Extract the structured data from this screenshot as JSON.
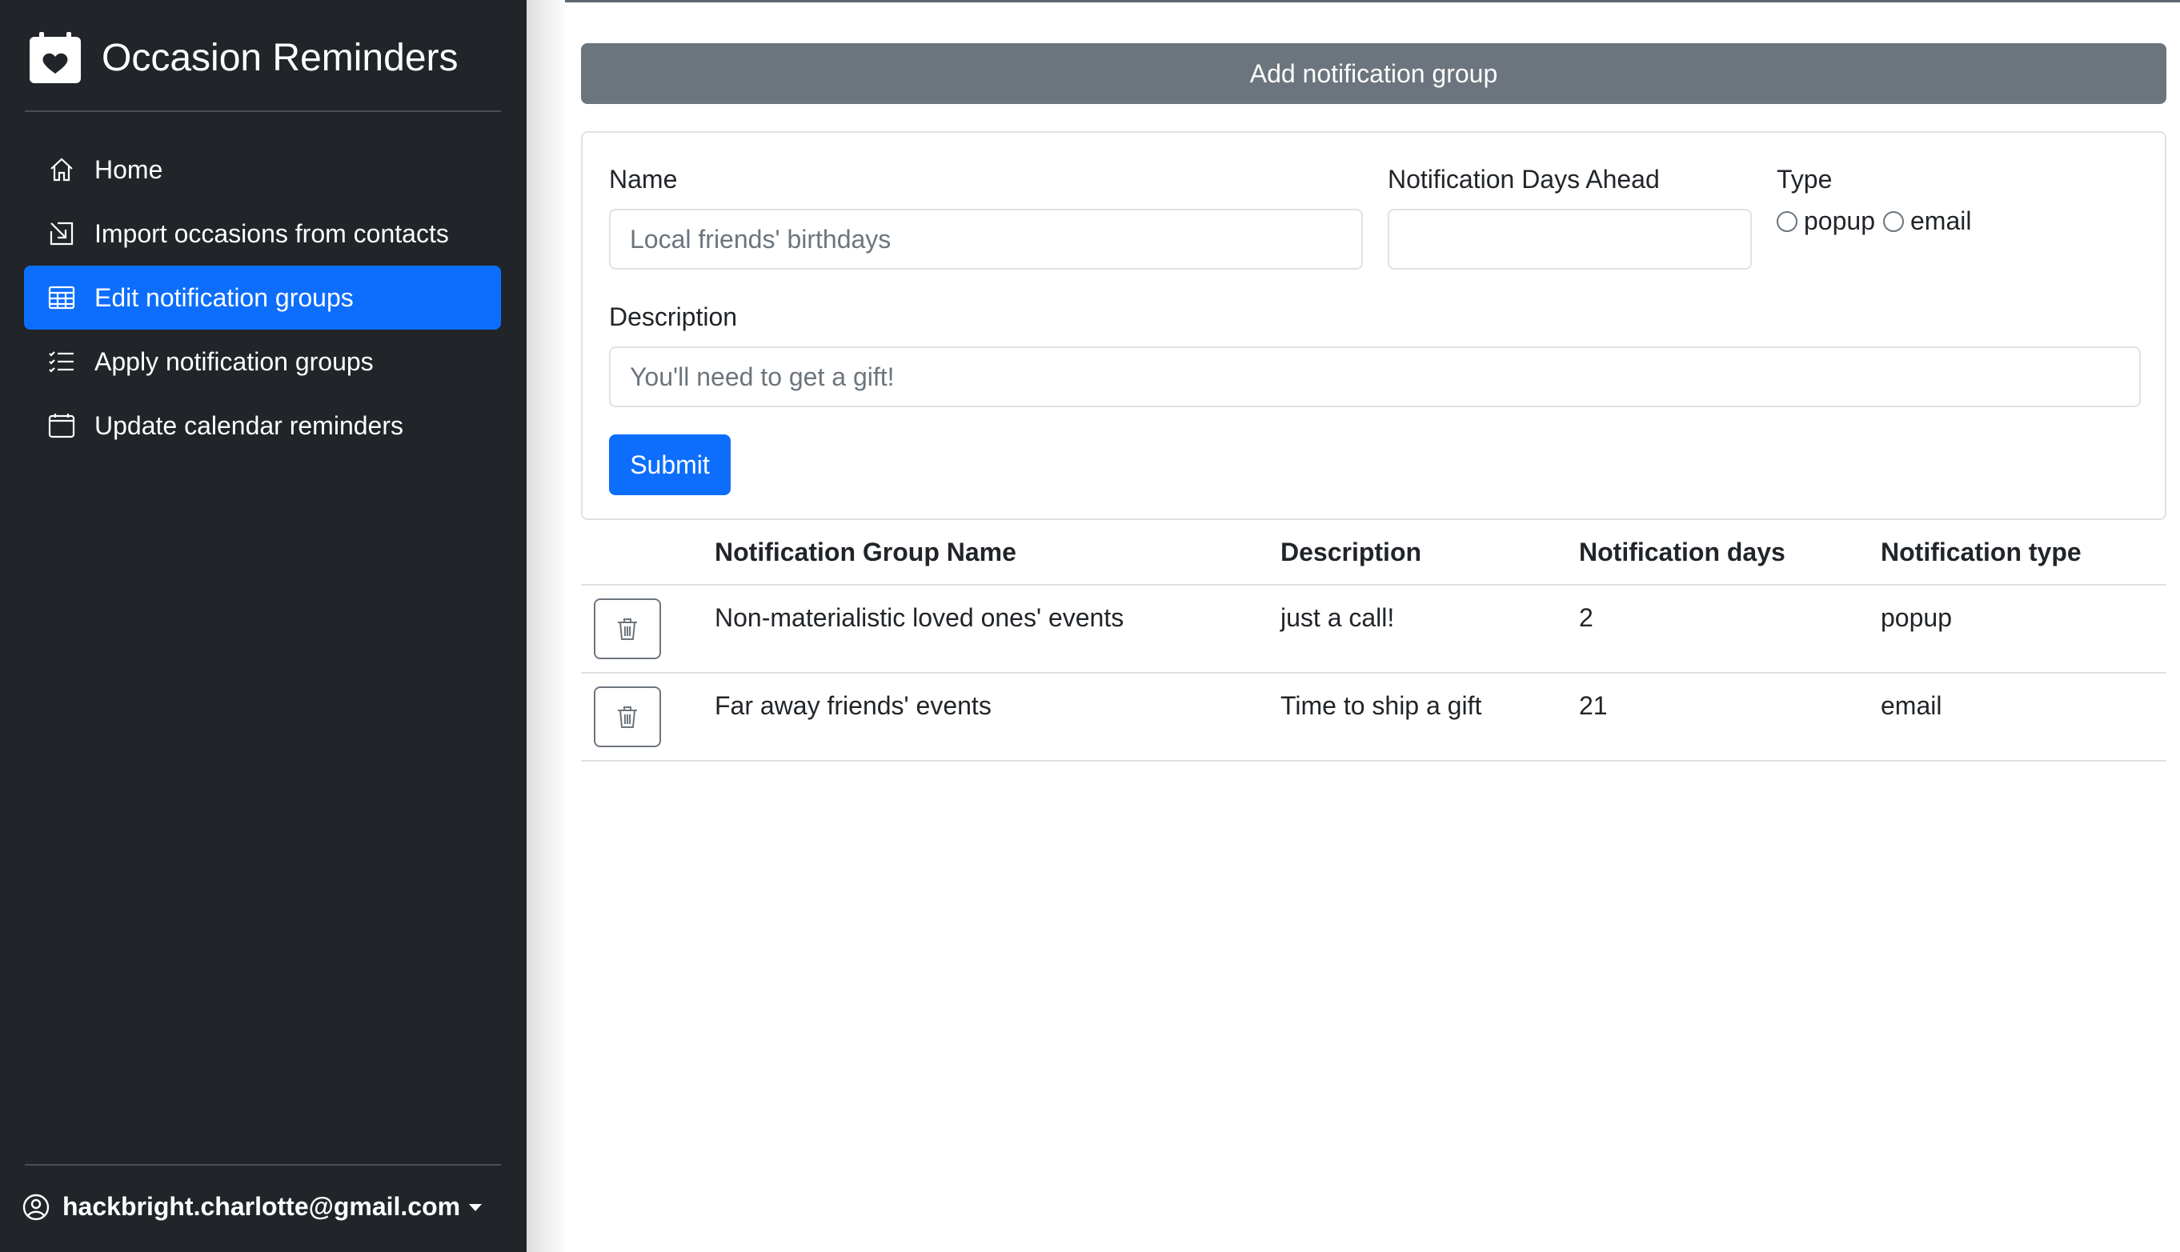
{
  "app": {
    "title": "Occasion Reminders",
    "icon": "calendar-heart-icon"
  },
  "sidebar": {
    "items": [
      {
        "label": "Home",
        "icon": "house-icon",
        "active": false
      },
      {
        "label": "Import occasions from contacts",
        "icon": "box-arrow-in-icon",
        "active": false
      },
      {
        "label": "Edit notification groups",
        "icon": "table-icon",
        "active": true
      },
      {
        "label": "Apply notification groups",
        "icon": "list-check-icon",
        "active": false
      },
      {
        "label": "Update calendar reminders",
        "icon": "calendar-icon",
        "active": false
      }
    ],
    "user": {
      "email": "hackbright.charlotte@gmail.com",
      "icon": "person-circle-icon"
    }
  },
  "main": {
    "header": "Add notification group",
    "form": {
      "name_label": "Name",
      "name_placeholder": "Local friends' birthdays",
      "days_label": "Notification Days Ahead",
      "days_value": "",
      "type_label": "Type",
      "type_options": [
        "popup",
        "email"
      ],
      "description_label": "Description",
      "description_placeholder": "You'll need to get a gift!",
      "submit_label": "Submit"
    },
    "table": {
      "columns": [
        "Notification Group Name",
        "Description",
        "Notification days",
        "Notification type"
      ],
      "rows": [
        {
          "name": "Non-materialistic loved ones' events",
          "description": "just a call!",
          "days": "2",
          "type": "popup"
        },
        {
          "name": "Far away friends' events",
          "description": "Time to ship a gift",
          "days": "21",
          "type": "email"
        }
      ]
    }
  },
  "colors": {
    "sidebar_bg": "#212529",
    "accent": "#0d6efd",
    "header_bg": "#6c757d"
  }
}
